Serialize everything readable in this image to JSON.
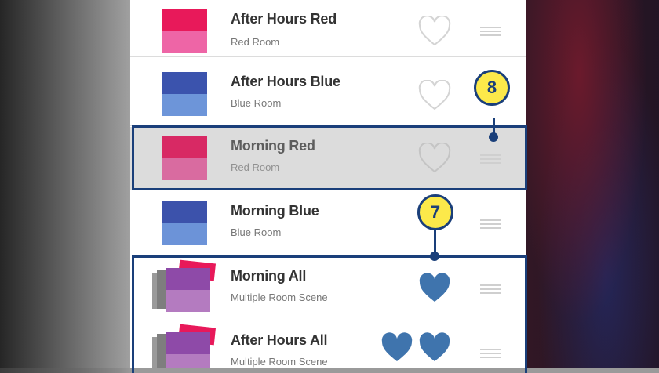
{
  "scenes": [
    {
      "name": "After Hours Red",
      "room": "Red Room",
      "favorite": false,
      "selected": false,
      "top_color": "#e8195a",
      "bottom_color": "#ee65a6"
    },
    {
      "name": "After Hours Blue",
      "room": "Blue Room",
      "favorite": false,
      "selected": false,
      "top_color": "#3b53ad",
      "bottom_color": "#6d95d9"
    },
    {
      "name": "Morning Red",
      "room": "Red Room",
      "favorite": false,
      "selected": true,
      "top_color": "#d82964",
      "bottom_color": "#d96ba0"
    },
    {
      "name": "Morning Blue",
      "room": "Blue Room",
      "favorite": false,
      "selected": false,
      "top_color": "#3c52ab",
      "bottom_color": "#6c93d8"
    },
    {
      "name": "Morning All",
      "room": "Multiple Room Scene",
      "favorite": true,
      "selected": false,
      "top_color": "#8e4aa8",
      "bottom_color": "#b47bc0"
    },
    {
      "name": "After Hours All",
      "room": "Multiple Room Scene",
      "favorite": true,
      "selected": false,
      "top_color": "#8e4aa8",
      "bottom_color": "#b47bc0"
    }
  ],
  "callouts": {
    "badge_7": "7",
    "badge_8": "8"
  },
  "colors": {
    "heart_filled": "#3f74ad",
    "heart_outline": "#d4d4d4",
    "callout_border": "#1a3f7a",
    "badge_fill": "#fce94a"
  }
}
